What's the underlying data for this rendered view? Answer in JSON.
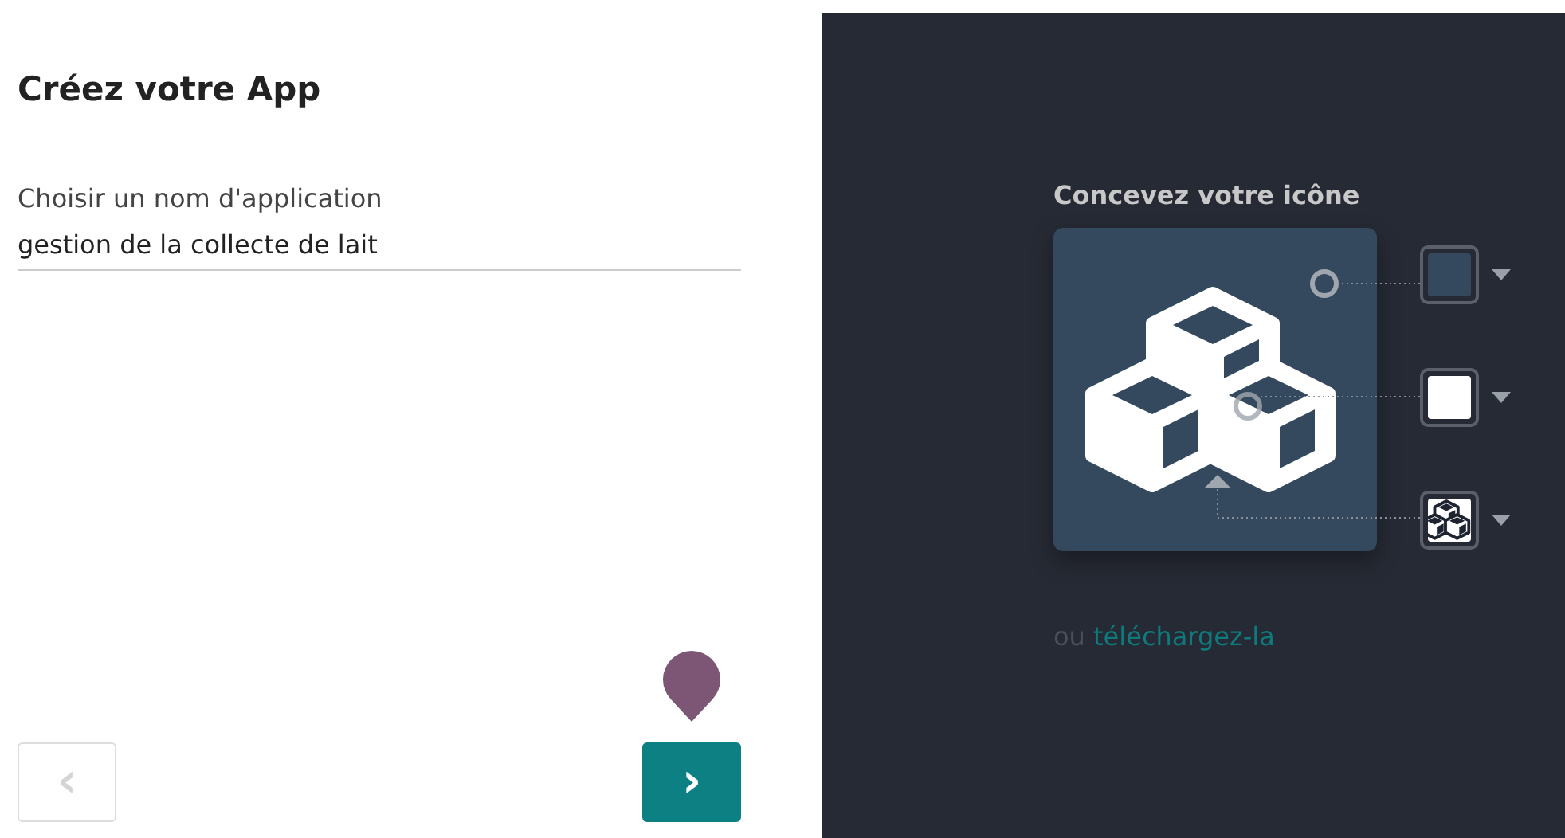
{
  "wizard": {
    "title": "Créez votre App",
    "field": {
      "label": "Choisir un nom d'application",
      "value": "gestion de la collecte de lait"
    },
    "previous": {
      "label": "‹",
      "disabled": true
    },
    "next": {
      "label": "›",
      "disabled": false
    }
  },
  "designer": {
    "heading": "Concevez votre icône",
    "swatches": [
      {
        "kind": "color",
        "color": "#34495e"
      },
      {
        "kind": "color",
        "color": "#ffffff"
      },
      {
        "kind": "icon"
      }
    ],
    "upload": {
      "prefix": "ou",
      "link": "téléchargez-la"
    }
  }
}
